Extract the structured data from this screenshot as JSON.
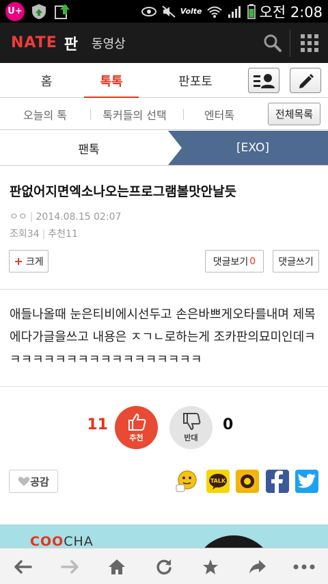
{
  "status_bar": {
    "carrier_badge": "U+",
    "network": "Volte",
    "time": "오전 2:08"
  },
  "header": {
    "logo": "NATE",
    "section": "판",
    "video_link": "동영상",
    "icons": [
      "search-icon",
      "grid-menu-icon"
    ]
  },
  "main_tabs": {
    "items": [
      "홈",
      "톡톡",
      "판포토"
    ],
    "active": "톡톡",
    "icons": [
      "list-profile-icon",
      "pencil-icon"
    ]
  },
  "sub_tabs": {
    "items": [
      "오늘의 톡",
      "톡커들의 선택",
      "엔터톡"
    ],
    "all_list": "전체목록"
  },
  "breadcrumb": {
    "parent": "팬톡",
    "current": "[EXO]"
  },
  "post": {
    "title": "판없어지면엑소나오는프로그램볼맛안날듯",
    "author": "ㅇㅇ",
    "date": "2014.08.15 02:07",
    "views": "조회34",
    "recommends": "추천11",
    "enlarge_label": "크게",
    "comments_view_label": "댓글보기",
    "comments_count": "0",
    "comment_write_label": "댓글쓰기",
    "body": "애들나올때 눈은티비에시선두고 손은바쁘게오타를내며 제목에다가글을쓰고 내용은 ㅈㄱㄴ로하는게 조카판의묘미인데ㅋㅋㅋㅋㅋㅋㅋㅋㅋㅋㅋㅋㅋㅋㅋㅋㅋㅋ"
  },
  "votes": {
    "up_count": "11",
    "up_label": "추천",
    "down_label": "반대",
    "down_count": "0"
  },
  "share": {
    "empathy_label": "공감",
    "targets": [
      "emoticon-share-icon",
      "kakaotalk-icon",
      "kakaostory-icon",
      "facebook-icon",
      "twitter-icon"
    ],
    "kakaotalk_text": "TALK"
  },
  "banner": {
    "brand_red": "COO",
    "brand_dark": "CHA"
  },
  "colors": {
    "accent": "#e8321d",
    "header_bg": "#1b1b1b",
    "breadcrumb_active": "#4f6a91",
    "facebook": "#3b5998",
    "twitter": "#1da1f2",
    "kakao": "#f7d600"
  }
}
